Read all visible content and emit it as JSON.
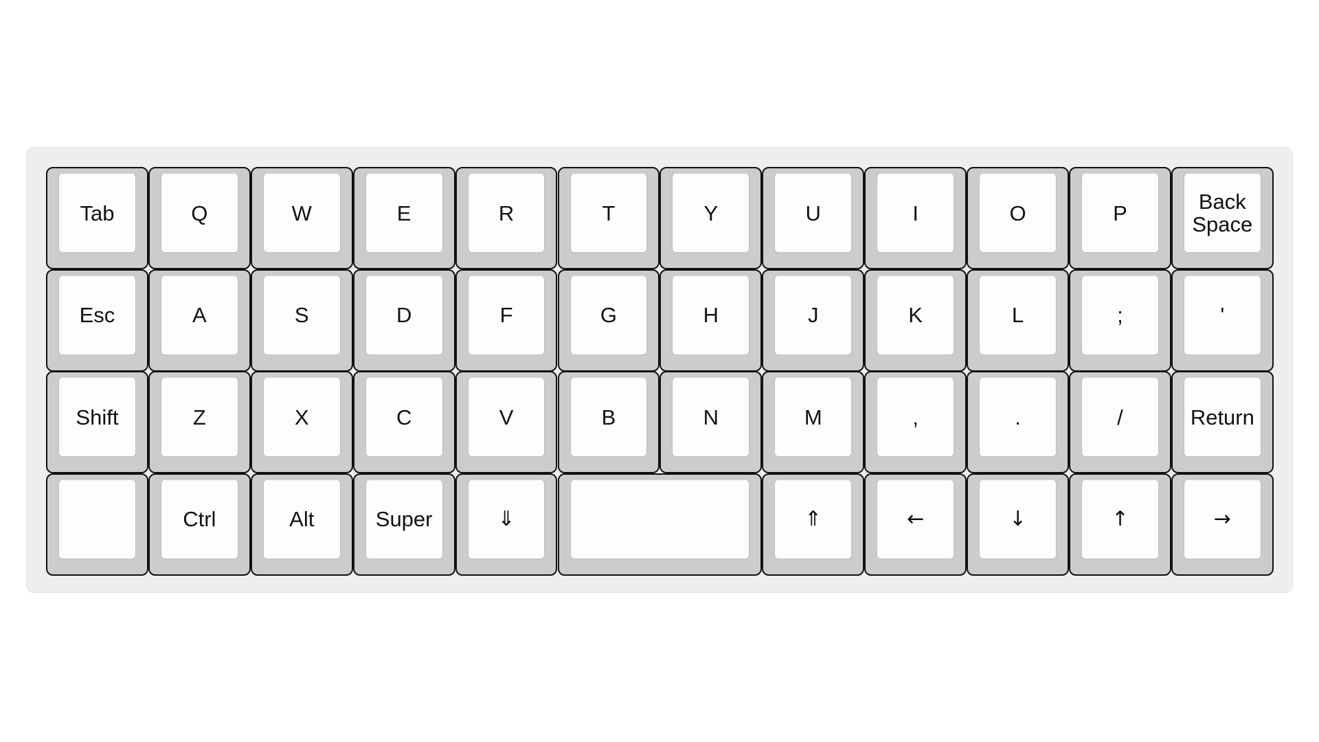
{
  "keyboard": {
    "name": "40% ortholinear keyboard layout",
    "colors": {
      "background": "#ffffff",
      "plate": "#eeeeee",
      "key_body": "#cccccc",
      "key_outline": "#111111",
      "keycap": "#fdfdfd",
      "legend": "#111111"
    },
    "rows": [
      [
        {
          "label": "Tab",
          "width_units": 1
        },
        {
          "label": "Q",
          "width_units": 1
        },
        {
          "label": "W",
          "width_units": 1
        },
        {
          "label": "E",
          "width_units": 1
        },
        {
          "label": "R",
          "width_units": 1
        },
        {
          "label": "T",
          "width_units": 1
        },
        {
          "label": "Y",
          "width_units": 1
        },
        {
          "label": "U",
          "width_units": 1
        },
        {
          "label": "I",
          "width_units": 1
        },
        {
          "label": "O",
          "width_units": 1
        },
        {
          "label": "P",
          "width_units": 1
        },
        {
          "label": "Back\nSpace",
          "width_units": 1
        }
      ],
      [
        {
          "label": "Esc",
          "width_units": 1
        },
        {
          "label": "A",
          "width_units": 1
        },
        {
          "label": "S",
          "width_units": 1
        },
        {
          "label": "D",
          "width_units": 1
        },
        {
          "label": "F",
          "width_units": 1
        },
        {
          "label": "G",
          "width_units": 1
        },
        {
          "label": "H",
          "width_units": 1
        },
        {
          "label": "J",
          "width_units": 1
        },
        {
          "label": "K",
          "width_units": 1
        },
        {
          "label": "L",
          "width_units": 1
        },
        {
          "label": ";",
          "width_units": 1
        },
        {
          "label": "'",
          "width_units": 1
        }
      ],
      [
        {
          "label": "Shift",
          "width_units": 1
        },
        {
          "label": "Z",
          "width_units": 1
        },
        {
          "label": "X",
          "width_units": 1
        },
        {
          "label": "C",
          "width_units": 1
        },
        {
          "label": "V",
          "width_units": 1
        },
        {
          "label": "B",
          "width_units": 1
        },
        {
          "label": "N",
          "width_units": 1
        },
        {
          "label": "M",
          "width_units": 1
        },
        {
          "label": ",",
          "width_units": 1
        },
        {
          "label": ".",
          "width_units": 1
        },
        {
          "label": "/",
          "width_units": 1
        },
        {
          "label": "Return",
          "width_units": 1
        }
      ],
      [
        {
          "label": "",
          "width_units": 1,
          "name": "blank"
        },
        {
          "label": "Ctrl",
          "width_units": 1
        },
        {
          "label": "Alt",
          "width_units": 1
        },
        {
          "label": "Super",
          "width_units": 1
        },
        {
          "label": "⇓",
          "width_units": 1,
          "name": "lower",
          "symbol": true
        },
        {
          "label": "",
          "width_units": 2,
          "name": "space"
        },
        {
          "label": "⇑",
          "width_units": 1,
          "name": "raise",
          "symbol": true
        },
        {
          "label": "←",
          "width_units": 1,
          "name": "arrow-left",
          "symbol": true
        },
        {
          "label": "↓",
          "width_units": 1,
          "name": "arrow-down",
          "symbol": true
        },
        {
          "label": "↑",
          "width_units": 1,
          "name": "arrow-up",
          "symbol": true
        },
        {
          "label": "→",
          "width_units": 1,
          "name": "arrow-right",
          "symbol": true
        }
      ]
    ]
  }
}
